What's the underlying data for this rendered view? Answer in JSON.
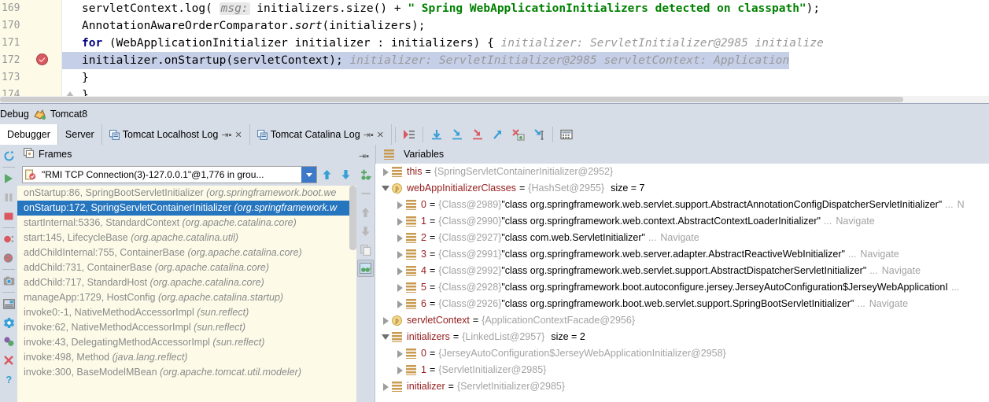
{
  "editor": {
    "lines": [
      {
        "no": "169",
        "breakpoint": false,
        "highlight": false,
        "segments": [
          {
            "t": "plain",
            "v": "        servletContext.log( "
          },
          {
            "t": "pill",
            "v": "msg:"
          },
          {
            "t": "plain",
            "v": " initializers.size() + "
          },
          {
            "t": "str",
            "v": "\" Spring WebApplicationInitializers detected on classpath\""
          },
          {
            "t": "plain",
            "v": ");"
          }
        ]
      },
      {
        "no": "170",
        "breakpoint": false,
        "highlight": false,
        "segments": [
          {
            "t": "plain",
            "v": "        AnnotationAwareOrderComparator."
          },
          {
            "t": "mi",
            "v": "sort"
          },
          {
            "t": "plain",
            "v": "(initializers);"
          }
        ]
      },
      {
        "no": "171",
        "breakpoint": false,
        "highlight": false,
        "segments": [
          {
            "t": "plain",
            "v": "        "
          },
          {
            "t": "kw",
            "v": "for"
          },
          {
            "t": "plain",
            "v": " (WebApplicationInitializer initializer : initializers) {"
          },
          {
            "t": "hint",
            "v": "   initializer: ServletInitializer@2985   initialize"
          }
        ]
      },
      {
        "no": "172",
        "breakpoint": true,
        "highlight": true,
        "segments": [
          {
            "t": "plain",
            "v": "            initializer.onStartup(servletContext);"
          },
          {
            "t": "hint",
            "v": "   initializer: ServletInitializer@2985   servletContext: Application"
          }
        ]
      },
      {
        "no": "173",
        "breakpoint": false,
        "highlight": false,
        "segments": [
          {
            "t": "plain",
            "v": "        }"
          }
        ]
      },
      {
        "no": "174",
        "breakpoint": false,
        "highlight": false,
        "foldmark": true,
        "segments": [
          {
            "t": "plain",
            "v": "    }"
          }
        ]
      }
    ]
  },
  "debug_window": {
    "title": "Debug",
    "config_name": "Tomcat8",
    "config_icon": "tomcat-cat-icon"
  },
  "tabs": [
    {
      "label": "Debugger",
      "active": true,
      "icon": null,
      "closable": false,
      "pin": false
    },
    {
      "label": "Server",
      "active": false,
      "icon": null,
      "closable": false,
      "pin": false
    },
    {
      "label": "Tomcat Localhost Log",
      "active": false,
      "icon": "console-icon",
      "closable": true,
      "pin": true
    },
    {
      "label": "Tomcat Catalina Log",
      "active": false,
      "icon": "console-icon",
      "closable": true,
      "pin": true
    }
  ],
  "toolbar_buttons": [
    {
      "name": "show-execution-point-icon",
      "title": "Show Execution Point"
    },
    {
      "name": "step-over-icon",
      "title": "Step Over"
    },
    {
      "name": "step-into-icon",
      "title": "Step Into"
    },
    {
      "name": "force-step-into-icon",
      "title": "Force Step Into"
    },
    {
      "name": "step-out-icon",
      "title": "Step Out"
    },
    {
      "name": "drop-frame-icon",
      "title": "Drop Frame"
    },
    {
      "name": "run-to-cursor-icon",
      "title": "Run to Cursor"
    },
    {
      "name": "evaluate-expression-icon",
      "title": "Evaluate Expression"
    }
  ],
  "left_strip_buttons": [
    {
      "name": "rerun-icon",
      "title": "Rerun"
    },
    {
      "name": "resume-program-icon",
      "title": "Resume Program"
    },
    {
      "name": "pause-program-icon",
      "title": "Pause Program"
    },
    {
      "name": "stop-icon",
      "title": "Stop"
    },
    {
      "name": "view-breakpoints-icon",
      "title": "View Breakpoints"
    },
    {
      "name": "mute-breakpoints-icon",
      "title": "Mute Breakpoints"
    },
    {
      "name": "get-thread-dump-icon",
      "title": "Get Thread Dump"
    },
    {
      "name": "settings-layout-icon",
      "title": "Layout Settings"
    },
    {
      "name": "settings-gear-icon",
      "title": "Settings"
    },
    {
      "name": "restore-layout-icon",
      "title": "Restore Layout"
    },
    {
      "name": "close-icon",
      "title": "Close"
    },
    {
      "name": "help-icon",
      "title": "Help"
    }
  ],
  "frames_panel": {
    "header": "Frames",
    "header_icon": "frames-icon",
    "thread_selector": {
      "icon": "thread-suspended-icon",
      "value": "\"RMI TCP Connection(3)-127.0.0.1\"@1,776 in grou...",
      "dropdown_icon": "chevron-down-icon"
    },
    "thread_toolbar": [
      {
        "name": "move-up-icon",
        "title": "Up"
      },
      {
        "name": "move-down-icon",
        "title": "Down"
      },
      {
        "name": "filter-icon",
        "title": "Filter"
      }
    ],
    "side_toolbar": [
      {
        "name": "add-watch-icon",
        "title": "New Watch"
      },
      {
        "name": "remove-watch-icon",
        "title": "Remove Watch"
      },
      {
        "name": "move-watch-up-icon",
        "title": "Move Up"
      },
      {
        "name": "move-watch-down-icon",
        "title": "Move Down"
      },
      {
        "name": "copy-value-icon",
        "title": "Copy Value"
      },
      {
        "name": "show-watches-icon",
        "title": "Show Watches",
        "active": true
      }
    ],
    "frames": [
      {
        "method": "onStartup:86, SpringBootServletInitializer",
        "package": "(org.springframework.boot.we",
        "selected": false
      },
      {
        "method": "onStartup:172, SpringServletContainerInitializer",
        "package": "(org.springframework.w",
        "selected": true
      },
      {
        "method": "startInternal:5336, StandardContext",
        "package": "(org.apache.catalina.core)",
        "selected": false
      },
      {
        "method": "start:145, LifecycleBase",
        "package": "(org.apache.catalina.util)",
        "selected": false
      },
      {
        "method": "addChildInternal:755, ContainerBase",
        "package": "(org.apache.catalina.core)",
        "selected": false
      },
      {
        "method": "addChild:731, ContainerBase",
        "package": "(org.apache.catalina.core)",
        "selected": false
      },
      {
        "method": "addChild:717, StandardHost",
        "package": "(org.apache.catalina.core)",
        "selected": false
      },
      {
        "method": "manageApp:1729, HostConfig",
        "package": "(org.apache.catalina.startup)",
        "selected": false
      },
      {
        "method": "invoke0:-1, NativeMethodAccessorImpl",
        "package": "(sun.reflect)",
        "selected": false
      },
      {
        "method": "invoke:62, NativeMethodAccessorImpl",
        "package": "(sun.reflect)",
        "selected": false
      },
      {
        "method": "invoke:43, DelegatingMethodAccessorImpl",
        "package": "(sun.reflect)",
        "selected": false
      },
      {
        "method": "invoke:498, Method",
        "package": "(java.lang.reflect)",
        "selected": false
      },
      {
        "method": "invoke:300, BaseModelMBean",
        "package": "(org.apache.tomcat.util.modeler)",
        "selected": false
      }
    ]
  },
  "variables_panel": {
    "header": "Variables",
    "header_icon": "variables-icon",
    "rows": [
      {
        "indent": 0,
        "toggle": "collapsed",
        "icon": "object",
        "name": "this",
        "ref": "{SpringServletContainerInitializer@2952}",
        "value": "",
        "size": "",
        "navigate": ""
      },
      {
        "indent": 0,
        "toggle": "expanded",
        "icon": "param",
        "name": "webAppInitializerClasses",
        "ref": "{HashSet@2955}",
        "value": "",
        "size": "size = 7",
        "navigate": ""
      },
      {
        "indent": 1,
        "toggle": "collapsed",
        "icon": "object",
        "name": "0",
        "ref": "{Class@2989}",
        "value": "\"class org.springframework.web.servlet.support.AbstractAnnotationConfigDispatcherServletInitializer\"",
        "ellipsis": "...",
        "size": "",
        "navigate": "N"
      },
      {
        "indent": 1,
        "toggle": "collapsed",
        "icon": "object",
        "name": "1",
        "ref": "{Class@2990}",
        "value": "\"class org.springframework.web.context.AbstractContextLoaderInitializer\"",
        "ellipsis": "...",
        "size": "",
        "navigate": "Navigate"
      },
      {
        "indent": 1,
        "toggle": "collapsed",
        "icon": "object",
        "name": "2",
        "ref": "{Class@2927}",
        "value": "\"class com.web.ServletInitializer\"",
        "ellipsis": "...",
        "size": "",
        "navigate": "Navigate"
      },
      {
        "indent": 1,
        "toggle": "collapsed",
        "icon": "object",
        "name": "3",
        "ref": "{Class@2991}",
        "value": "\"class org.springframework.web.server.adapter.AbstractReactiveWebInitializer\"",
        "ellipsis": "...",
        "size": "",
        "navigate": "Navigate"
      },
      {
        "indent": 1,
        "toggle": "collapsed",
        "icon": "object",
        "name": "4",
        "ref": "{Class@2992}",
        "value": "\"class org.springframework.web.servlet.support.AbstractDispatcherServletInitializer\"",
        "ellipsis": "...",
        "size": "",
        "navigate": "Navigate"
      },
      {
        "indent": 1,
        "toggle": "collapsed",
        "icon": "object",
        "name": "5",
        "ref": "{Class@2928}",
        "value": "\"class org.springframework.boot.autoconfigure.jersey.JerseyAutoConfiguration$JerseyWebApplicationI",
        "ellipsis": "...",
        "size": "",
        "navigate": ""
      },
      {
        "indent": 1,
        "toggle": "collapsed",
        "icon": "object",
        "name": "6",
        "ref": "{Class@2926}",
        "value": "\"class org.springframework.boot.web.servlet.support.SpringBootServletInitializer\"",
        "ellipsis": "...",
        "size": "",
        "navigate": "Navigate"
      },
      {
        "indent": 0,
        "toggle": "collapsed",
        "icon": "param",
        "name": "servletContext",
        "ref": "{ApplicationContextFacade@2956}",
        "value": "",
        "size": "",
        "navigate": ""
      },
      {
        "indent": 0,
        "toggle": "expanded",
        "icon": "object",
        "name": "initializers",
        "ref": "{LinkedList@2957}",
        "value": "",
        "size": "size = 2",
        "navigate": ""
      },
      {
        "indent": 1,
        "toggle": "collapsed",
        "icon": "object",
        "name": "0",
        "ref": "{JerseyAutoConfiguration$JerseyWebApplicationInitializer@2958}",
        "value": "",
        "size": "",
        "navigate": ""
      },
      {
        "indent": 1,
        "toggle": "collapsed",
        "icon": "object",
        "name": "1",
        "ref": "{ServletInitializer@2985}",
        "value": "",
        "size": "",
        "navigate": ""
      },
      {
        "indent": 0,
        "toggle": "collapsed",
        "icon": "object",
        "name": "initializer",
        "ref": "{ServletInitializer@2985}",
        "value": "",
        "size": "",
        "navigate": ""
      }
    ]
  },
  "colors": {
    "selection_blue": "#2675bf",
    "code_highlight": "#c5cfe8",
    "frames_bg": "#fdfbe8",
    "panel_bg": "#d6dde7",
    "string_green": "#008000",
    "keyword_navy": "#000080",
    "var_name_red": "#951b1b",
    "breakpoint_red": "#db5860"
  }
}
